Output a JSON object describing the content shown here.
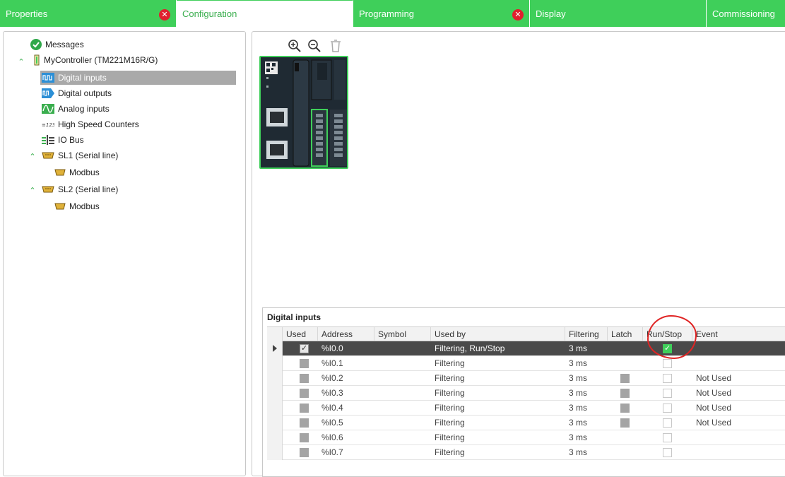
{
  "tabs": [
    {
      "label": "Properties",
      "error": true,
      "active": false
    },
    {
      "label": "Configuration",
      "error": false,
      "active": true
    },
    {
      "label": "Programming",
      "error": true,
      "active": false
    },
    {
      "label": "Display",
      "error": false,
      "active": false
    },
    {
      "label": "Commissioning",
      "error": false,
      "active": false
    }
  ],
  "tree": {
    "messages": "Messages",
    "controller": "MyController (TM221M16R/G)",
    "items": [
      {
        "label": "Digital inputs"
      },
      {
        "label": "Digital outputs"
      },
      {
        "label": "Analog inputs"
      },
      {
        "label": "High Speed Counters"
      },
      {
        "label": "IO Bus"
      },
      {
        "label": "SL1 (Serial line)"
      },
      {
        "label": "Modbus"
      },
      {
        "label": "SL2 (Serial line)"
      },
      {
        "label": "Modbus"
      }
    ]
  },
  "icons": {
    "zoom_in": "zoom-in-icon",
    "zoom_out": "zoom-out-icon",
    "delete": "trash-icon",
    "error": "error-icon",
    "ok": "check-circle-icon"
  },
  "colors": {
    "accent": "#3fcf5a",
    "error": "#e0202e",
    "selected_row": "#4a4a4a",
    "annotation": "#e02424"
  },
  "grid": {
    "title": "Digital inputs",
    "columns": [
      "Used",
      "Address",
      "Symbol",
      "Used by",
      "Filtering",
      "Latch",
      "Run/Stop",
      "Event"
    ],
    "rows": [
      {
        "used": "checked",
        "address": "%I0.0",
        "symbol": "",
        "used_by": "Filtering, Run/Stop",
        "filtering": "3 ms",
        "latch": "none",
        "runstop": "checked",
        "event": "",
        "selected": true
      },
      {
        "used": "gray",
        "address": "%I0.1",
        "symbol": "",
        "used_by": "Filtering",
        "filtering": "3 ms",
        "latch": "none",
        "runstop": "empty",
        "event": "",
        "selected": false
      },
      {
        "used": "gray",
        "address": "%I0.2",
        "symbol": "",
        "used_by": "Filtering",
        "filtering": "3 ms",
        "latch": "gray",
        "runstop": "empty",
        "event": "Not Used",
        "selected": false
      },
      {
        "used": "gray",
        "address": "%I0.3",
        "symbol": "",
        "used_by": "Filtering",
        "filtering": "3 ms",
        "latch": "gray",
        "runstop": "empty",
        "event": "Not Used",
        "selected": false
      },
      {
        "used": "gray",
        "address": "%I0.4",
        "symbol": "",
        "used_by": "Filtering",
        "filtering": "3 ms",
        "latch": "gray",
        "runstop": "empty",
        "event": "Not Used",
        "selected": false
      },
      {
        "used": "gray",
        "address": "%I0.5",
        "symbol": "",
        "used_by": "Filtering",
        "filtering": "3 ms",
        "latch": "gray",
        "runstop": "empty",
        "event": "Not Used",
        "selected": false
      },
      {
        "used": "gray",
        "address": "%I0.6",
        "symbol": "",
        "used_by": "Filtering",
        "filtering": "3 ms",
        "latch": "none",
        "runstop": "empty",
        "event": "",
        "selected": false
      },
      {
        "used": "gray",
        "address": "%I0.7",
        "symbol": "",
        "used_by": "Filtering",
        "filtering": "3 ms",
        "latch": "none",
        "runstop": "empty",
        "event": "",
        "selected": false
      }
    ]
  }
}
